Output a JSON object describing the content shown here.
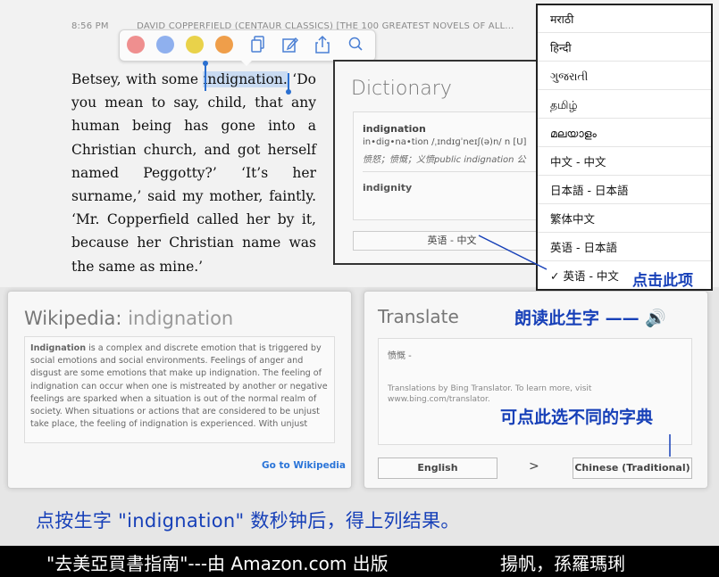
{
  "status_bar": {
    "time": "8:56 PM",
    "book_title": "DAVID COPPERFIELD (CENTAUR CLASSICS) [THE 100 GREATEST NOVELS OF ALL..."
  },
  "highlight_colors": [
    "#ef8f8f",
    "#8fb0ee",
    "#e9d24a",
    "#ef9e4a"
  ],
  "passage": {
    "before": "Betsey, with some ",
    "selected": "indignation.",
    "after": " ‘Do you mean to say, child, that any human being has gone into a Christian church, and got herself named Peggotty?’ ‘It’s her surname,’ said my mother, faintly. ‘Mr. Copperfield called her by it, because her Christian name was the same as mine.’"
  },
  "dictionary": {
    "title": "Dictionary",
    "word": "indignation",
    "pronunciation": "in•dig•na•tion /ˌɪndɪɡˈneɪʃ(ə)n/ n [U]",
    "definition": "愤怒；愤慨；义愤public indignation 公",
    "word2": "indignity",
    "selected_dictionary": "英语 - 中文"
  },
  "language_menu": {
    "items": [
      "मराठी",
      "हिन्दी",
      "ગુજરાતી",
      "தமிழ்",
      "മലയാളം",
      "中文 - 中文",
      "日本語 - 日本語",
      "繁体中文",
      "英语 - 日本語",
      "英语 - 中文"
    ],
    "selected_index": 9,
    "check_mark": "✓",
    "annotation": "点击此项"
  },
  "wikipedia": {
    "title": "Wikipedia:",
    "query": "indignation",
    "bold_term": "Indignation",
    "text": " is a complex and discrete emotion that is triggered by social emotions and social environments.  Feelings of anger and disgust are some emotions that make up indignation. The feeling of indignation can occur when one is mistreated by another or negative feelings are sparked when a situation is out of the normal realm of society. When situations or actions that are considered to be unjust take place, the feeling of indignation is experienced. With unjust",
    "link": "Go to Wikipedia"
  },
  "translate": {
    "title": "Translate",
    "speak_annotation": "朗读此生字 —— 🔊",
    "result": "愤慨 -",
    "credit": "Translations by Bing Translator. To learn more, visit www.bing.com/translator.",
    "pick_annotation": "可点此选不同的字典",
    "from": "English",
    "arrow": ">",
    "to": "Chinese (Traditional)"
  },
  "caption": "点按生字 \"indignation\" 数秒钟后，得上列结果。",
  "footer": {
    "text": "\"去美亞買書指南\"---由 Amazon.com 出版",
    "author": "揚帆，孫羅瑪琍"
  }
}
